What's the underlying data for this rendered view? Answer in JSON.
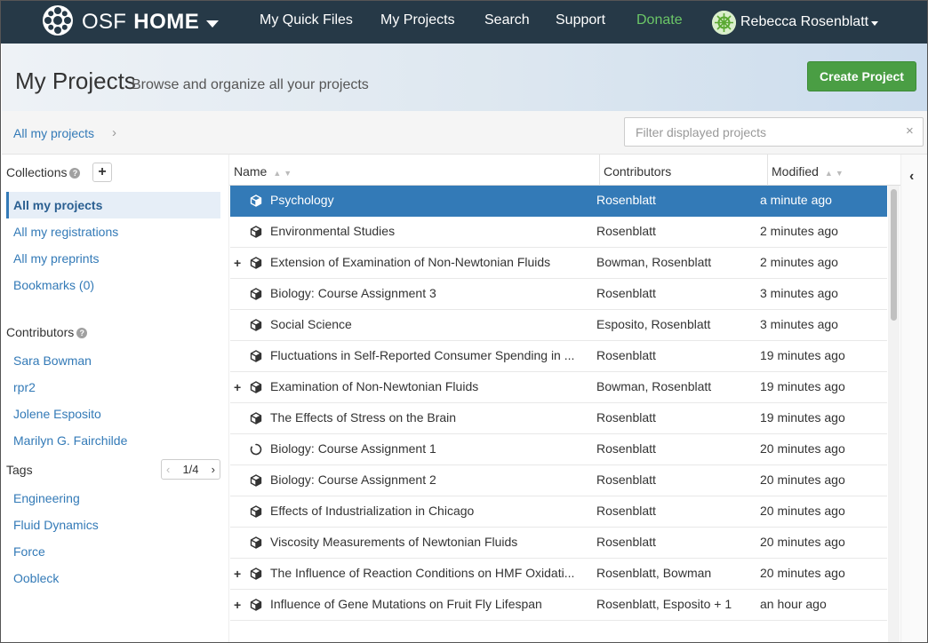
{
  "navbar": {
    "brand_osf": "OSF",
    "brand_home": "HOME",
    "links": [
      "My Quick Files",
      "My Projects",
      "Search",
      "Support",
      "Donate"
    ],
    "user_name": "Rebecca Rosenblatt",
    "bg_color": "#263947",
    "donate_color": "#6bc667"
  },
  "header": {
    "title": "My Projects",
    "subtitle": "Browse and organize all your projects",
    "create_button": "Create Project"
  },
  "breadcrumb": {
    "label": "All my projects",
    "chevron": "›"
  },
  "filter": {
    "placeholder": "Filter displayed projects",
    "clear": "×"
  },
  "sidebar": {
    "collections_label": "Collections",
    "collections": [
      "All my projects",
      "All my registrations",
      "All my preprints",
      "Bookmarks (0)"
    ],
    "contributors_label": "Contributors",
    "contributors": [
      "Sara Bowman",
      "rpr2",
      "Jolene Esposito",
      "Marilyn G. Fairchilde"
    ],
    "tags_label": "Tags",
    "tags_page": "1/4",
    "tags": [
      "Engineering",
      "Fluid Dynamics",
      "Force",
      "Oobleck"
    ]
  },
  "table": {
    "headers": {
      "name": "Name",
      "contributors": "Contributors",
      "modified": "Modified"
    },
    "rows": [
      {
        "name": "Psychology",
        "contributors": "Rosenblatt",
        "modified": "a minute ago",
        "expandable": false,
        "icon": "cube-icon",
        "selected": true
      },
      {
        "name": "Environmental Studies",
        "contributors": "Rosenblatt",
        "modified": "2 minutes ago",
        "expandable": false,
        "icon": "cube-icon",
        "selected": false
      },
      {
        "name": "Extension of Examination of Non-Newtonian Fluids",
        "contributors": "Bowman, Rosenblatt",
        "modified": "2 minutes ago",
        "expandable": true,
        "icon": "cube-icon",
        "selected": false
      },
      {
        "name": "Biology: Course Assignment 3",
        "contributors": "Rosenblatt",
        "modified": "3 minutes ago",
        "expandable": false,
        "icon": "cube-icon",
        "selected": false
      },
      {
        "name": "Social Science",
        "contributors": "Esposito, Rosenblatt",
        "modified": "3 minutes ago",
        "expandable": false,
        "icon": "cube-icon",
        "selected": false
      },
      {
        "name": "Fluctuations in Self-Reported Consumer Spending in ...",
        "contributors": "Rosenblatt",
        "modified": "19 minutes ago",
        "expandable": false,
        "icon": "cube-icon",
        "selected": false
      },
      {
        "name": "Examination of Non-Newtonian Fluids",
        "contributors": "Bowman, Rosenblatt",
        "modified": "19 minutes ago",
        "expandable": true,
        "icon": "cube-icon",
        "selected": false
      },
      {
        "name": "The Effects of Stress on the Brain",
        "contributors": "Rosenblatt",
        "modified": "19 minutes ago",
        "expandable": false,
        "icon": "cube-icon",
        "selected": false
      },
      {
        "name": "Biology: Course Assignment 1",
        "contributors": "Rosenblatt",
        "modified": "20 minutes ago",
        "expandable": false,
        "icon": "loading-icon",
        "selected": false
      },
      {
        "name": "Biology: Course Assignment 2",
        "contributors": "Rosenblatt",
        "modified": "20 minutes ago",
        "expandable": false,
        "icon": "cube-icon",
        "selected": false
      },
      {
        "name": "Effects of Industrialization in Chicago",
        "contributors": "Rosenblatt",
        "modified": "20 minutes ago",
        "expandable": false,
        "icon": "cube-icon",
        "selected": false
      },
      {
        "name": "Viscosity Measurements of Newtonian Fluids",
        "contributors": "Rosenblatt",
        "modified": "20 minutes ago",
        "expandable": false,
        "icon": "cube-icon",
        "selected": false
      },
      {
        "name": "The Influence of Reaction Conditions on HMF Oxidati...",
        "contributors": "Rosenblatt, Bowman",
        "modified": "20 minutes ago",
        "expandable": true,
        "icon": "cube-icon",
        "selected": false
      },
      {
        "name": "Influence of Gene Mutations on Fruit Fly Lifespan",
        "contributors": "Rosenblatt, Esposito + 1",
        "modified": "an hour ago",
        "expandable": true,
        "icon": "cube-icon",
        "selected": false
      }
    ]
  },
  "colors": {
    "accent": "#337ab7",
    "create_button": "#4a9e44",
    "selected_row": "#337ab7"
  }
}
